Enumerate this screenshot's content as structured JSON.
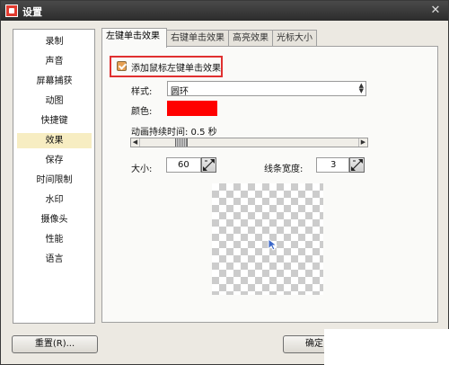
{
  "window": {
    "title": "设置",
    "close_glyph": "✕"
  },
  "sidebar": {
    "items": [
      {
        "label": "录制"
      },
      {
        "label": "声音"
      },
      {
        "label": "屏幕捕获"
      },
      {
        "label": "动图"
      },
      {
        "label": "快捷键"
      },
      {
        "label": "效果",
        "selected": true
      },
      {
        "label": "保存"
      },
      {
        "label": "时间限制"
      },
      {
        "label": "水印"
      },
      {
        "label": "摄像头"
      },
      {
        "label": "性能"
      },
      {
        "label": "语言"
      }
    ]
  },
  "tabs": [
    {
      "label": "左键单击效果",
      "active": true
    },
    {
      "label": "右键单击效果"
    },
    {
      "label": "高亮效果"
    },
    {
      "label": "光标大小"
    }
  ],
  "left_click": {
    "enable_label": "添加鼠标左键单击效果",
    "enable_checked": true,
    "style_label": "样式:",
    "style_value": "圆环",
    "color_label": "颜色:",
    "color_value": "#ff0000",
    "duration_label": "动画持续时间: 0.5 秒",
    "size_label": "大小:",
    "size_value": "60",
    "line_width_label": "线条宽度:",
    "line_width_value": "3"
  },
  "footer": {
    "reset_label": "重置(R)...",
    "ok_label": "确定"
  },
  "colors": {
    "highlight_border": "#e03030",
    "selected_item": "#f7edc2",
    "checkbox_fill": "#e6a052"
  },
  "icons": [
    "app-icon",
    "close-icon",
    "select-arrows-icon",
    "scroll-left-icon",
    "scroll-right-icon",
    "spin-arrows-icon",
    "cursor-arrow-icon"
  ]
}
